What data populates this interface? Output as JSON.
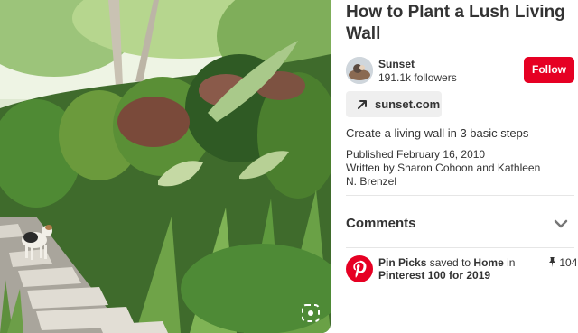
{
  "pin": {
    "title": "How to Plant a Lush Living Wall",
    "description": "Create a living wall in 3 basic steps",
    "published": "Published February 16, 2010",
    "written": "Written by Sharon Cohoon and Kathleen N. Brenzel"
  },
  "creator": {
    "name": "Sunset",
    "followers": "191.1k followers",
    "follow_label": "Follow"
  },
  "source_link": {
    "label": "sunset.com",
    "icon": "arrow-up-right-icon"
  },
  "comments": {
    "title": "Comments",
    "toggle_icon": "chevron-down-icon"
  },
  "activity": {
    "user": "Pin Picks",
    "verb": " saved to ",
    "board": "Home",
    "connector": " in ",
    "section": "Pinterest 100 for 2019",
    "count": "104",
    "count_icon": "pin-icon"
  },
  "colors": {
    "brand_red": "#e60023",
    "link_bg": "#efefef",
    "text": "#333333"
  }
}
